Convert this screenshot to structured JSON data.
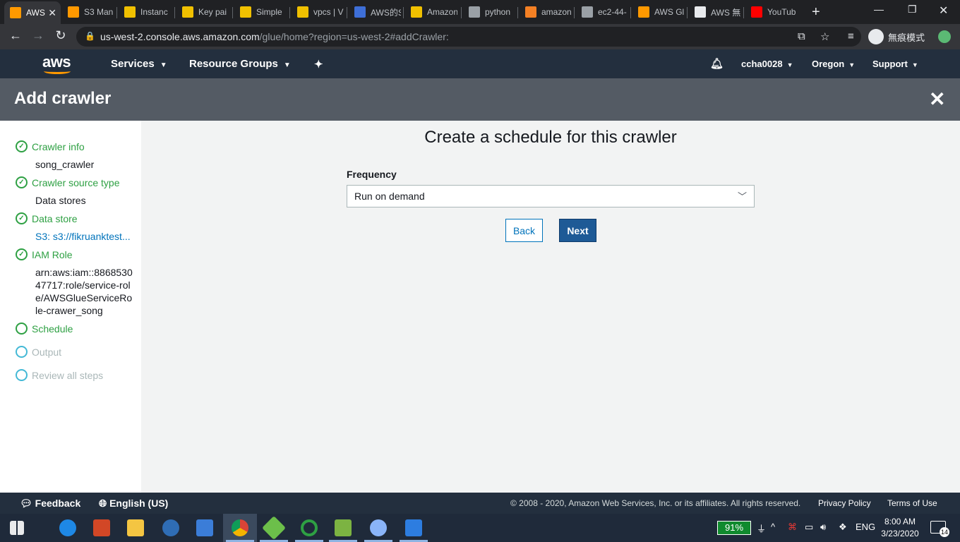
{
  "browser": {
    "tabs": [
      {
        "title": "AWS",
        "favicon": "aws-orange-cube-icon",
        "color": "#ff9900",
        "active": true
      },
      {
        "title": "S3 Man",
        "favicon": "aws-orange-cube-icon",
        "color": "#ff9900"
      },
      {
        "title": "Instanc",
        "favicon": "aws-box-icon",
        "color": "#f0c000"
      },
      {
        "title": "Key pai",
        "favicon": "aws-box-icon",
        "color": "#f0c000"
      },
      {
        "title": "Simple",
        "favicon": "aws-box-icon",
        "color": "#f0c000"
      },
      {
        "title": "vpcs | V",
        "favicon": "aws-box-icon",
        "color": "#f0c000"
      },
      {
        "title": "AWS的S",
        "favicon": "blue-cube-icon",
        "color": "#3e6fd8"
      },
      {
        "title": "Amazon",
        "favicon": "aws-box-icon",
        "color": "#f0c000"
      },
      {
        "title": "python",
        "favicon": "tools-icon",
        "color": "#9aa0a6"
      },
      {
        "title": "amazon",
        "favicon": "stackoverflow-icon",
        "color": "#f48024"
      },
      {
        "title": "ec2-44-",
        "favicon": "globe-icon",
        "color": "#9aa0a6"
      },
      {
        "title": "AWS Gl",
        "favicon": "aws-orange-cube-icon",
        "color": "#ff9900"
      },
      {
        "title": "AWS 無",
        "favicon": "rocket-icon",
        "color": "#e8eaed"
      },
      {
        "title": "YouTub",
        "favicon": "youtube-icon",
        "color": "#ff0000"
      }
    ],
    "url_main": "us-west-2.console.aws.amazon.com",
    "url_path": "/glue/home?region=us-west-2#addCrawler:",
    "incognito_label": "無痕模式"
  },
  "awsnav": {
    "services": "Services",
    "resource_groups": "Resource Groups",
    "user": "ccha0028",
    "region": "Oregon",
    "support": "Support"
  },
  "page": {
    "title": "Add crawler"
  },
  "steps": [
    {
      "label": "Crawler info",
      "value": "song_crawler",
      "state": "done"
    },
    {
      "label": "Crawler source type",
      "value": "Data stores",
      "state": "done"
    },
    {
      "label": "Data store",
      "value": "S3: s3://fikruanktest...",
      "state": "done"
    },
    {
      "label": "IAM Role",
      "value": "arn:aws:iam::886853047717:role/service-role/AWSGlueServiceRole-crawer_song",
      "state": "done"
    },
    {
      "label": "Schedule",
      "state": "current"
    },
    {
      "label": "Output",
      "state": "todo"
    },
    {
      "label": "Review all steps",
      "state": "todo"
    }
  ],
  "main": {
    "heading": "Create a schedule for this crawler",
    "frequency_label": "Frequency",
    "frequency_value": "Run on demand",
    "back_label": "Back",
    "next_label": "Next"
  },
  "footer": {
    "feedback": "Feedback",
    "language": "English (US)",
    "copyright": "© 2008 - 2020, Amazon Web Services, Inc. or its affiliates. All rights reserved.",
    "privacy": "Privacy Policy",
    "terms": "Terms of Use"
  },
  "taskbar": {
    "battery": "91%",
    "lang": "ENG",
    "time": "8:00 AM",
    "date": "3/23/2020",
    "notifications": "14"
  }
}
